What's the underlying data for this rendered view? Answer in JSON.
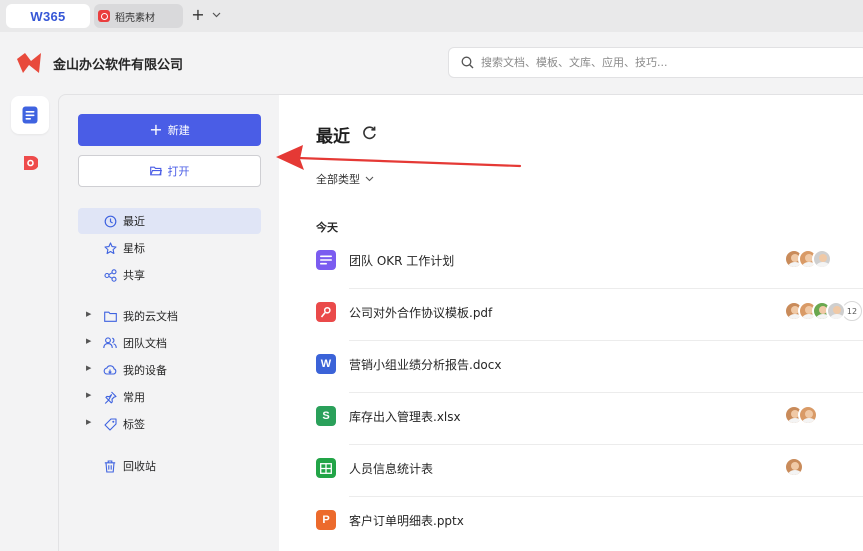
{
  "tabs": {
    "w365_label": "W365",
    "daoke_label": "稻壳素材"
  },
  "header": {
    "company_name": "金山办公软件有限公司",
    "search_placeholder": "搜索文档、模板、文库、应用、技巧..."
  },
  "sidebar": {
    "new_label": "新建",
    "open_label": "打开",
    "items": [
      {
        "label": "最近",
        "icon": "clock-icon"
      },
      {
        "label": "星标",
        "icon": "star-icon"
      },
      {
        "label": "共享",
        "icon": "share-icon"
      },
      {
        "label": "我的云文档",
        "icon": "folder-icon"
      },
      {
        "label": "团队文档",
        "icon": "team-icon"
      },
      {
        "label": "我的设备",
        "icon": "cloud-device-icon"
      },
      {
        "label": "常用",
        "icon": "pin-icon"
      },
      {
        "label": "标签",
        "icon": "tag-icon"
      },
      {
        "label": "回收站",
        "icon": "trash-icon"
      }
    ]
  },
  "main": {
    "title": "最近",
    "filter_label": "全部类型",
    "section_today": "今天",
    "files": [
      {
        "name": "团队 OKR 工作计划",
        "type": "doc",
        "icon_text": "",
        "color": "#7b5cf0"
      },
      {
        "name": "公司对外合作协议模板.pdf",
        "type": "pdf",
        "icon_text": "",
        "color": "#ea4a4a",
        "extra_count": "12"
      },
      {
        "name": "营销小组业绩分析报告.docx",
        "type": "word",
        "icon_text": "W",
        "color": "#3b63d8"
      },
      {
        "name": "库存出入管理表.xlsx",
        "type": "excel",
        "icon_text": "S",
        "color": "#2aa05a"
      },
      {
        "name": "人员信息统计表",
        "type": "form",
        "icon_text": "",
        "color": "#22a447"
      },
      {
        "name": "客户订单明细表.pptx",
        "type": "ppt",
        "icon_text": "P",
        "color": "#ec6a2c"
      }
    ]
  },
  "colors": {
    "accent": "#4a5de6",
    "arrow": "#e53935"
  }
}
